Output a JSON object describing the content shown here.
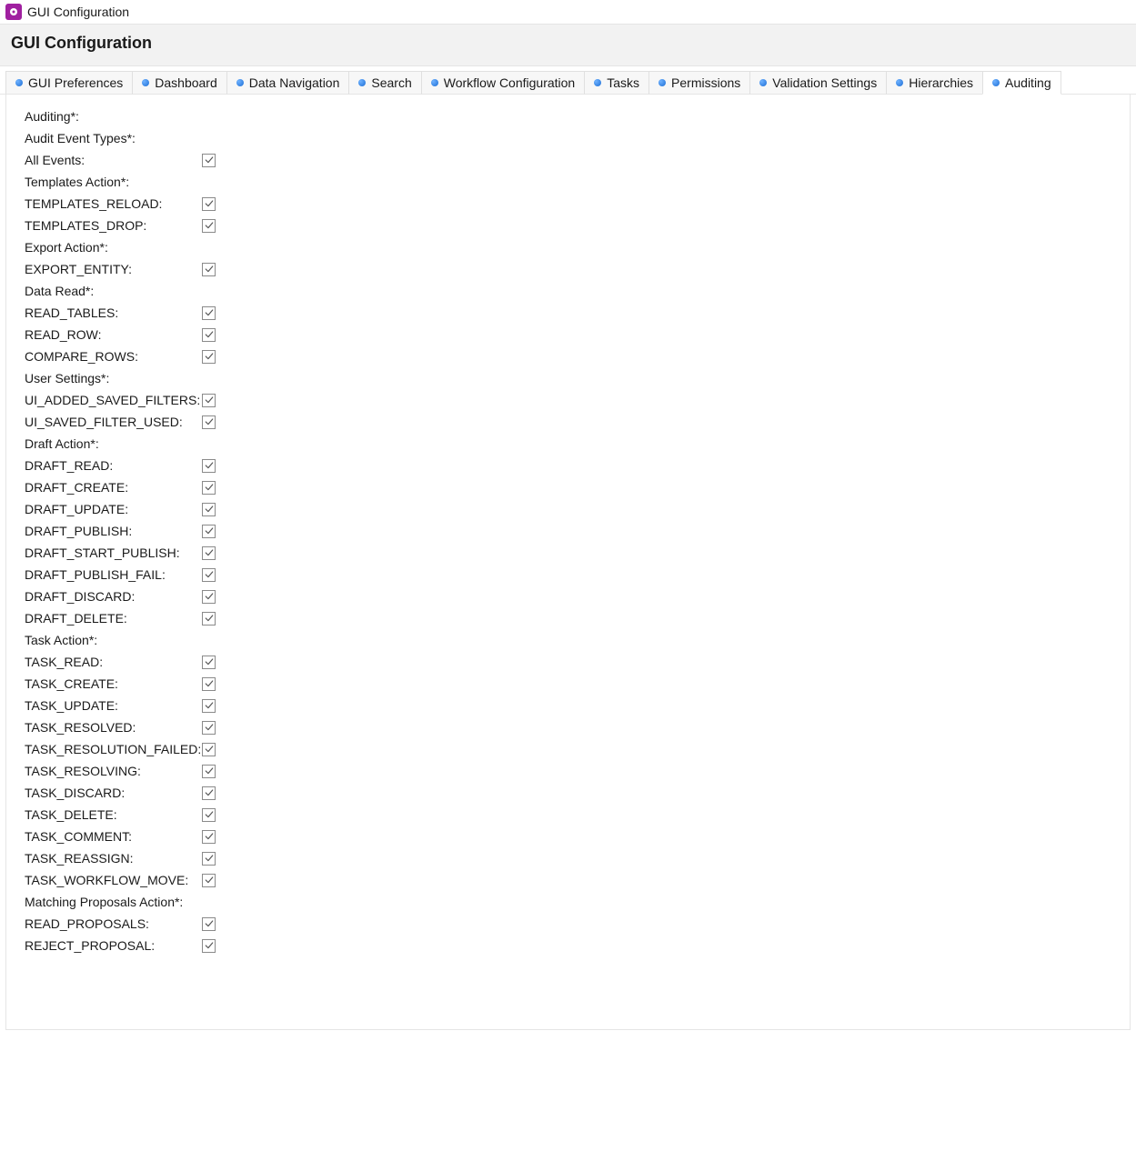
{
  "window_title": "GUI Configuration",
  "page_title": "GUI Configuration",
  "tabs": [
    {
      "label": "GUI Preferences",
      "active": false
    },
    {
      "label": "Dashboard",
      "active": false
    },
    {
      "label": "Data Navigation",
      "active": false
    },
    {
      "label": "Search",
      "active": false
    },
    {
      "label": "Workflow Configuration",
      "active": false
    },
    {
      "label": "Tasks",
      "active": false
    },
    {
      "label": "Permissions",
      "active": false
    },
    {
      "label": "Validation Settings",
      "active": false
    },
    {
      "label": "Hierarchies",
      "active": false
    },
    {
      "label": "Auditing",
      "active": true
    }
  ],
  "panel": {
    "rows": [
      {
        "type": "group",
        "label": "Auditing*:"
      },
      {
        "type": "group",
        "label": "Audit Event Types*:"
      },
      {
        "type": "check",
        "label": "All Events:",
        "checked": true
      },
      {
        "type": "group",
        "label": "Templates Action*:"
      },
      {
        "type": "check",
        "label": "TEMPLATES_RELOAD:",
        "checked": true
      },
      {
        "type": "check",
        "label": "TEMPLATES_DROP:",
        "checked": true
      },
      {
        "type": "group",
        "label": "Export Action*:"
      },
      {
        "type": "check",
        "label": "EXPORT_ENTITY:",
        "checked": true
      },
      {
        "type": "group",
        "label": "Data Read*:"
      },
      {
        "type": "check",
        "label": "READ_TABLES:",
        "checked": true
      },
      {
        "type": "check",
        "label": "READ_ROW:",
        "checked": true
      },
      {
        "type": "check",
        "label": "COMPARE_ROWS:",
        "checked": true
      },
      {
        "type": "group",
        "label": "User Settings*:"
      },
      {
        "type": "check",
        "label": "UI_ADDED_SAVED_FILTERS:",
        "checked": true
      },
      {
        "type": "check",
        "label": "UI_SAVED_FILTER_USED:",
        "checked": true
      },
      {
        "type": "group",
        "label": "Draft Action*:"
      },
      {
        "type": "check",
        "label": "DRAFT_READ:",
        "checked": true
      },
      {
        "type": "check",
        "label": "DRAFT_CREATE:",
        "checked": true
      },
      {
        "type": "check",
        "label": "DRAFT_UPDATE:",
        "checked": true
      },
      {
        "type": "check",
        "label": "DRAFT_PUBLISH:",
        "checked": true
      },
      {
        "type": "check",
        "label": "DRAFT_START_PUBLISH:",
        "checked": true
      },
      {
        "type": "check",
        "label": "DRAFT_PUBLISH_FAIL:",
        "checked": true
      },
      {
        "type": "check",
        "label": "DRAFT_DISCARD:",
        "checked": true
      },
      {
        "type": "check",
        "label": "DRAFT_DELETE:",
        "checked": true
      },
      {
        "type": "group",
        "label": "Task Action*:"
      },
      {
        "type": "check",
        "label": "TASK_READ:",
        "checked": true
      },
      {
        "type": "check",
        "label": "TASK_CREATE:",
        "checked": true
      },
      {
        "type": "check",
        "label": "TASK_UPDATE:",
        "checked": true
      },
      {
        "type": "check",
        "label": "TASK_RESOLVED:",
        "checked": true
      },
      {
        "type": "check",
        "label": "TASK_RESOLUTION_FAILED:",
        "checked": true
      },
      {
        "type": "check",
        "label": "TASK_RESOLVING:",
        "checked": true
      },
      {
        "type": "check",
        "label": "TASK_DISCARD:",
        "checked": true
      },
      {
        "type": "check",
        "label": "TASK_DELETE:",
        "checked": true
      },
      {
        "type": "check",
        "label": "TASK_COMMENT:",
        "checked": true
      },
      {
        "type": "check",
        "label": "TASK_REASSIGN:",
        "checked": true
      },
      {
        "type": "check",
        "label": "TASK_WORKFLOW_MOVE:",
        "checked": true
      },
      {
        "type": "group",
        "label": "Matching Proposals Action*:"
      },
      {
        "type": "check",
        "label": "READ_PROPOSALS:",
        "checked": true
      },
      {
        "type": "check",
        "label": "REJECT_PROPOSAL:",
        "checked": true
      }
    ]
  }
}
